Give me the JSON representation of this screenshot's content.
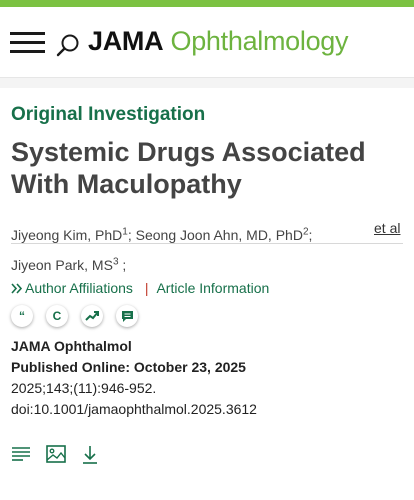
{
  "header": {
    "brand": "JAMA",
    "journal": "Ophthalmology",
    "menu_icon": "hamburger-menu-icon",
    "search_icon": "search-icon",
    "accent_color": "#7cc242"
  },
  "article": {
    "type": "Original Investigation",
    "title": "Systemic Drugs Associated With Maculopathy",
    "authors": [
      {
        "name": "Jiyeong Kim, PhD",
        "sup": "1",
        "after": "; "
      },
      {
        "name": "Seong Joon Ahn, MD, PhD",
        "sup": "2",
        "after": ";"
      },
      {
        "name": "Jiyeon Park, MS",
        "sup": "3",
        "after": " ;"
      }
    ],
    "et_al": "et al",
    "links": {
      "author_affiliations": "Author Affiliations",
      "separator": "|",
      "article_information": "Article Information"
    },
    "action_icons": [
      "quote-icon",
      "copyright-icon",
      "trending-metrics-icon",
      "comment-icon"
    ],
    "action_glyphs": {
      "quote": "“",
      "copyright": "C"
    },
    "journal_name": "JAMA Ophthalmol",
    "published": "Published Online: October 23, 2025",
    "citation": "2025;143;(11):946-952.",
    "doi": "doi:10.1001/jamaophthalmol.2025.3612"
  },
  "toolbar": {
    "icons": [
      "full-text-icon",
      "figures-icon",
      "download-icon"
    ]
  },
  "colors": {
    "green": "#17704a",
    "separator": "#c0392b"
  }
}
